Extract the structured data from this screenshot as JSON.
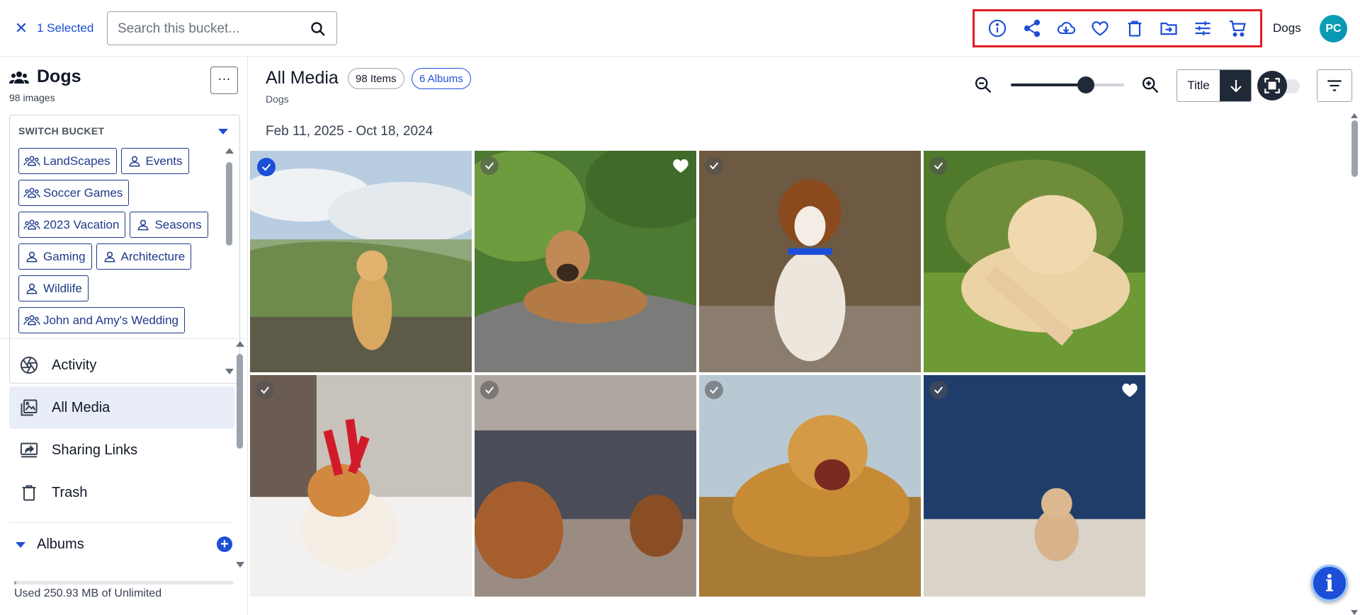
{
  "header": {
    "selected_label": "1 Selected",
    "search_placeholder": "Search this bucket...",
    "actions": [
      {
        "icon": "info-icon",
        "label": "Info"
      },
      {
        "icon": "share-icon",
        "label": "Share"
      },
      {
        "icon": "cloud-download-icon",
        "label": "Download"
      },
      {
        "icon": "heart-icon",
        "label": "Favorite"
      },
      {
        "icon": "trash-icon",
        "label": "Delete"
      },
      {
        "icon": "move-folder-icon",
        "label": "Move"
      },
      {
        "icon": "adjust-icon",
        "label": "Edit"
      },
      {
        "icon": "cart-icon",
        "label": "Order"
      }
    ],
    "bucket_name": "Dogs",
    "avatar_initials": "PC"
  },
  "sidebar": {
    "bucket_title": "Dogs",
    "bucket_count": "98 images",
    "switch_label": "SWITCH BUCKET",
    "buckets": [
      {
        "label": "LandScapes",
        "icon": "group-icon"
      },
      {
        "label": "Events",
        "icon": "person-icon"
      },
      {
        "label": "Soccer Games",
        "icon": "group-icon"
      },
      {
        "label": "2023 Vacation",
        "icon": "group-icon"
      },
      {
        "label": "Seasons",
        "icon": "person-icon"
      },
      {
        "label": "Gaming",
        "icon": "person-icon"
      },
      {
        "label": "Architecture",
        "icon": "person-icon"
      },
      {
        "label": "Wildlife",
        "icon": "person-icon"
      },
      {
        "label": "John and Amy's Wedding",
        "icon": "group-icon"
      }
    ],
    "nav": [
      {
        "label": "Activity",
        "icon": "aperture-icon",
        "active": false
      },
      {
        "label": "All Media",
        "icon": "images-icon",
        "active": true
      },
      {
        "label": "Sharing Links",
        "icon": "screen-share-icon",
        "active": false
      },
      {
        "label": "Trash",
        "icon": "trash-icon",
        "active": false
      }
    ],
    "albums_label": "Albums",
    "storage_text": "Used 250.93 MB of Unlimited"
  },
  "main": {
    "title": "All Media",
    "items_badge": "98 Items",
    "albums_badge": "6 Albums",
    "breadcrumb": "Dogs",
    "sort_label": "Title",
    "date_range": "Feb 11, 2025 - Oct 18, 2024",
    "photos": [
      {
        "subject": "Golden retriever sitting on a mountain overlook",
        "selected": true,
        "favorite": false
      },
      {
        "subject": "Brown puppy lying on a rock",
        "selected": false,
        "favorite": true
      },
      {
        "subject": "Jack Russell terrier standing on boardwalk",
        "selected": false,
        "favorite": false
      },
      {
        "subject": "Golden retriever chewing a bone in grass",
        "selected": false,
        "favorite": false
      },
      {
        "subject": "Corgi with reindeer antlers in snow",
        "selected": false,
        "favorite": false
      },
      {
        "subject": "Two dachshund puppies by a sofa",
        "selected": false,
        "favorite": false
      },
      {
        "subject": "Yawning golden retriever in field",
        "selected": false,
        "favorite": false
      },
      {
        "subject": "Small poodle puppy on pavement",
        "selected": false,
        "favorite": true
      }
    ]
  },
  "colors": {
    "accent": "#1d4ed8",
    "highlight_box": "#e11d26",
    "active_nav_bg": "#e8edf8"
  }
}
